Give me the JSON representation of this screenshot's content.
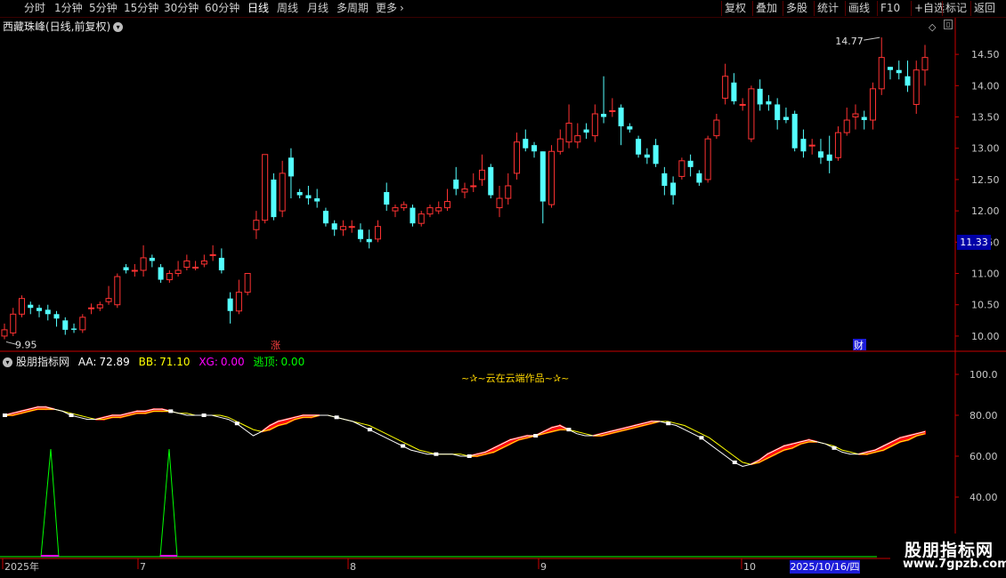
{
  "toolbar": {
    "periods": [
      "分时",
      "1分钟",
      "5分钟",
      "15分钟",
      "30分钟",
      "60分钟",
      "日线",
      "周线",
      "月线",
      "多周期",
      "更多"
    ],
    "active_period": "日线",
    "right_buttons": [
      "复权",
      "叠加",
      "多股",
      "统计",
      "画线",
      "F10",
      "+自选",
      "标记",
      "返回"
    ]
  },
  "stock_title": "西藏珠峰(日线,前复权)",
  "price_axis": {
    "ticks": [
      "14.50",
      "14.00",
      "13.50",
      "13.00",
      "12.50",
      "12.00",
      "11.50",
      "11.00",
      "10.50",
      "10.00"
    ],
    "current_price": "11.33",
    "high_marker": "14.77",
    "low_marker": "9.95"
  },
  "markers": {
    "zhang": "涨",
    "cai": "财"
  },
  "indicator": {
    "name": "股朋指标网",
    "aa_label": "AA:",
    "aa_value": "72.89",
    "bb_label": "BB:",
    "bb_value": "71.10",
    "xg_label": "XG:",
    "xg_value": "0.00",
    "tp_label": "逃顶:",
    "tp_value": "0.00",
    "credit": "~✰~云在云端作品~✰~",
    "ticks": [
      "100.0",
      "80.00",
      "60.00",
      "40.00",
      "20.00"
    ]
  },
  "date_axis": {
    "labels": [
      "2025年",
      "7",
      "8",
      "9",
      "10"
    ],
    "highlight": "2025/10/16/四"
  },
  "brand": {
    "name": "股朋指标网",
    "url": "www.7gpzb.com"
  },
  "colors": {
    "up": "#ff3232",
    "down": "#54ffff",
    "axis": "#c80000",
    "aa": "#ffffff",
    "bb": "#ffff00",
    "xg": "#ff00ff",
    "tp": "#00ff00"
  },
  "chart_data": [
    {
      "type": "candlestick",
      "title": "西藏珠峰(日线,前复权)",
      "ylim": [
        9.8,
        14.8
      ],
      "candles": [
        [
          10.0,
          10.1,
          9.95,
          10.2
        ],
        [
          10.05,
          10.35,
          10.0,
          10.45
        ],
        [
          10.35,
          10.6,
          10.3,
          10.65
        ],
        [
          10.5,
          10.45,
          10.35,
          10.55
        ],
        [
          10.45,
          10.4,
          10.3,
          10.5
        ],
        [
          10.42,
          10.35,
          10.25,
          10.5
        ],
        [
          10.35,
          10.28,
          10.15,
          10.4
        ],
        [
          10.25,
          10.1,
          10.02,
          10.3
        ],
        [
          10.12,
          10.1,
          10.05,
          10.2
        ],
        [
          10.1,
          10.3,
          10.05,
          10.35
        ],
        [
          10.45,
          10.45,
          10.35,
          10.52
        ],
        [
          10.45,
          10.5,
          10.4,
          10.55
        ],
        [
          10.55,
          10.6,
          10.5,
          10.8
        ],
        [
          10.5,
          10.95,
          10.45,
          11.0
        ],
        [
          11.1,
          11.05,
          11.0,
          11.15
        ],
        [
          11.05,
          11.05,
          10.95,
          11.15
        ],
        [
          11.05,
          11.25,
          10.95,
          11.45
        ],
        [
          11.25,
          11.2,
          11.1,
          11.3
        ],
        [
          11.1,
          10.9,
          10.85,
          11.15
        ],
        [
          10.9,
          11.0,
          10.85,
          11.05
        ],
        [
          11.0,
          11.05,
          10.95,
          11.2
        ],
        [
          11.1,
          11.2,
          11.05,
          11.3
        ],
        [
          11.1,
          11.1,
          11.05,
          11.2
        ],
        [
          11.15,
          11.2,
          11.1,
          11.3
        ],
        [
          11.3,
          11.3,
          11.2,
          11.45
        ],
        [
          11.25,
          11.05,
          11.0,
          11.4
        ],
        [
          10.6,
          10.4,
          10.2,
          10.7
        ],
        [
          10.4,
          10.7,
          10.35,
          10.9
        ],
        [
          10.7,
          11.0,
          10.65,
          11.0
        ],
        [
          11.7,
          11.85,
          11.55,
          12.0
        ],
        [
          11.85,
          12.9,
          11.8,
          12.9
        ],
        [
          12.5,
          11.9,
          11.85,
          12.6
        ],
        [
          12.0,
          12.6,
          11.9,
          12.8
        ],
        [
          12.85,
          12.55,
          12.2,
          13.0
        ],
        [
          12.3,
          12.25,
          12.2,
          12.35
        ],
        [
          12.25,
          12.2,
          12.1,
          12.4
        ],
        [
          12.2,
          12.15,
          12.05,
          12.35
        ],
        [
          12.0,
          11.8,
          11.75,
          12.05
        ],
        [
          11.8,
          11.7,
          11.6,
          11.85
        ],
        [
          11.7,
          11.75,
          11.6,
          11.85
        ],
        [
          11.75,
          11.75,
          11.65,
          11.85
        ],
        [
          11.7,
          11.55,
          11.5,
          11.8
        ],
        [
          11.55,
          11.5,
          11.4,
          11.7
        ],
        [
          11.55,
          11.75,
          11.5,
          11.85
        ],
        [
          12.3,
          12.1,
          12.0,
          12.45
        ],
        [
          12.0,
          12.05,
          11.9,
          12.1
        ],
        [
          12.05,
          12.1,
          12.0,
          12.15
        ],
        [
          12.05,
          11.8,
          11.75,
          12.1
        ],
        [
          11.8,
          11.95,
          11.75,
          12.0
        ],
        [
          11.95,
          12.05,
          11.9,
          12.1
        ],
        [
          12.0,
          12.05,
          11.95,
          12.15
        ],
        [
          12.05,
          12.15,
          12.0,
          12.35
        ],
        [
          12.5,
          12.35,
          12.25,
          12.7
        ],
        [
          12.3,
          12.35,
          12.2,
          12.45
        ],
        [
          12.4,
          12.4,
          12.3,
          12.6
        ],
        [
          12.5,
          12.65,
          12.4,
          12.9
        ],
        [
          12.7,
          12.25,
          12.2,
          12.75
        ],
        [
          12.05,
          12.2,
          11.9,
          12.4
        ],
        [
          12.2,
          12.4,
          12.1,
          12.6
        ],
        [
          12.6,
          13.1,
          12.5,
          13.25
        ],
        [
          13.15,
          13.0,
          12.95,
          13.3
        ],
        [
          13.05,
          12.95,
          12.85,
          13.1
        ],
        [
          12.95,
          12.15,
          11.8,
          12.95
        ],
        [
          12.1,
          12.95,
          12.05,
          13.05
        ],
        [
          12.95,
          13.15,
          12.9,
          13.3
        ],
        [
          13.1,
          13.4,
          13.0,
          13.7
        ],
        [
          13.1,
          13.2,
          13.0,
          13.4
        ],
        [
          13.3,
          13.25,
          13.15,
          13.4
        ],
        [
          13.2,
          13.55,
          13.1,
          13.7
        ],
        [
          13.55,
          13.5,
          13.4,
          14.15
        ],
        [
          13.6,
          13.6,
          13.5,
          13.8
        ],
        [
          13.65,
          13.35,
          13.05,
          13.7
        ],
        [
          13.35,
          13.3,
          13.25,
          13.4
        ],
        [
          13.15,
          12.9,
          12.85,
          13.2
        ],
        [
          12.9,
          12.85,
          12.75,
          13.0
        ],
        [
          13.05,
          12.75,
          12.7,
          13.15
        ],
        [
          12.6,
          12.4,
          12.25,
          12.7
        ],
        [
          12.45,
          12.25,
          12.1,
          12.55
        ],
        [
          12.55,
          12.8,
          12.5,
          12.85
        ],
        [
          12.8,
          12.7,
          12.55,
          12.9
        ],
        [
          12.6,
          12.45,
          12.4,
          12.65
        ],
        [
          12.5,
          13.15,
          12.45,
          13.2
        ],
        [
          13.2,
          13.45,
          13.15,
          13.55
        ],
        [
          13.8,
          14.15,
          13.7,
          14.35
        ],
        [
          14.05,
          13.75,
          13.7,
          14.2
        ],
        [
          13.7,
          13.7,
          13.6,
          13.8
        ],
        [
          13.15,
          13.95,
          13.1,
          14.0
        ],
        [
          13.95,
          13.7,
          13.6,
          14.1
        ],
        [
          13.75,
          13.7,
          13.6,
          13.85
        ],
        [
          13.7,
          13.45,
          13.3,
          13.8
        ],
        [
          13.5,
          13.45,
          13.4,
          13.65
        ],
        [
          13.55,
          13.0,
          12.95,
          13.6
        ],
        [
          13.15,
          12.95,
          12.85,
          13.3
        ],
        [
          13.05,
          13.05,
          12.9,
          13.15
        ],
        [
          12.95,
          12.85,
          12.75,
          13.15
        ],
        [
          12.9,
          12.8,
          12.6,
          13.2
        ],
        [
          12.85,
          13.25,
          12.8,
          13.35
        ],
        [
          13.25,
          13.45,
          13.2,
          13.65
        ],
        [
          13.5,
          13.55,
          13.3,
          13.7
        ],
        [
          13.5,
          13.45,
          13.3,
          13.6
        ],
        [
          13.45,
          13.95,
          13.3,
          14.05
        ],
        [
          13.95,
          14.45,
          13.85,
          14.77
        ],
        [
          14.3,
          14.25,
          14.1,
          14.3
        ],
        [
          14.25,
          14.2,
          14.1,
          14.4
        ],
        [
          14.15,
          14.0,
          13.9,
          14.4
        ],
        [
          13.7,
          14.25,
          13.55,
          14.4
        ],
        [
          14.25,
          14.45,
          14.0,
          14.65
        ]
      ]
    },
    {
      "type": "line",
      "title": "股朋指标网",
      "ylim": [
        10,
        110
      ],
      "series": [
        {
          "name": "AA",
          "values": [
            80,
            81,
            82,
            83,
            84,
            84,
            83,
            82,
            80,
            79,
            78,
            78,
            79,
            80,
            80,
            81,
            82,
            82,
            83,
            83,
            82,
            81,
            80,
            80,
            80,
            80,
            79,
            78,
            76,
            73,
            70,
            72,
            75,
            77,
            78,
            79,
            80,
            80,
            80,
            80,
            79,
            78,
            77,
            75,
            73,
            71,
            69,
            67,
            65,
            63,
            62,
            61,
            61,
            61,
            61,
            60,
            60,
            61,
            62,
            64,
            66,
            68,
            69,
            70,
            70,
            72,
            74,
            75,
            73,
            71,
            70,
            70,
            71,
            72,
            73,
            74,
            75,
            76,
            77,
            77,
            76,
            75,
            73,
            71,
            69,
            66,
            63,
            60,
            57,
            55,
            56,
            58,
            61,
            63,
            65,
            66,
            67,
            68,
            67,
            66,
            64,
            62,
            61,
            61,
            62,
            63,
            65,
            67,
            69,
            70,
            71,
            72
          ]
        },
        {
          "name": "BB",
          "values": [
            80,
            80,
            81,
            82,
            83,
            83,
            83,
            82,
            81,
            80,
            79,
            78,
            78,
            79,
            79,
            80,
            81,
            81,
            82,
            82,
            82,
            81,
            81,
            80,
            80,
            80,
            80,
            79,
            77,
            75,
            73,
            72,
            73,
            75,
            76,
            78,
            79,
            79,
            80,
            80,
            79,
            78,
            77,
            76,
            75,
            73,
            71,
            69,
            67,
            65,
            63,
            62,
            61,
            61,
            61,
            61,
            60,
            60,
            61,
            62,
            64,
            66,
            68,
            69,
            70,
            71,
            72,
            73,
            73,
            72,
            71,
            70,
            70,
            71,
            72,
            73,
            74,
            75,
            76,
            77,
            77,
            76,
            75,
            73,
            71,
            69,
            66,
            63,
            60,
            57,
            56,
            57,
            59,
            61,
            63,
            64,
            66,
            67,
            67,
            66,
            65,
            63,
            62,
            61,
            61,
            62,
            63,
            65,
            67,
            68,
            70,
            71
          ]
        }
      ]
    }
  ]
}
